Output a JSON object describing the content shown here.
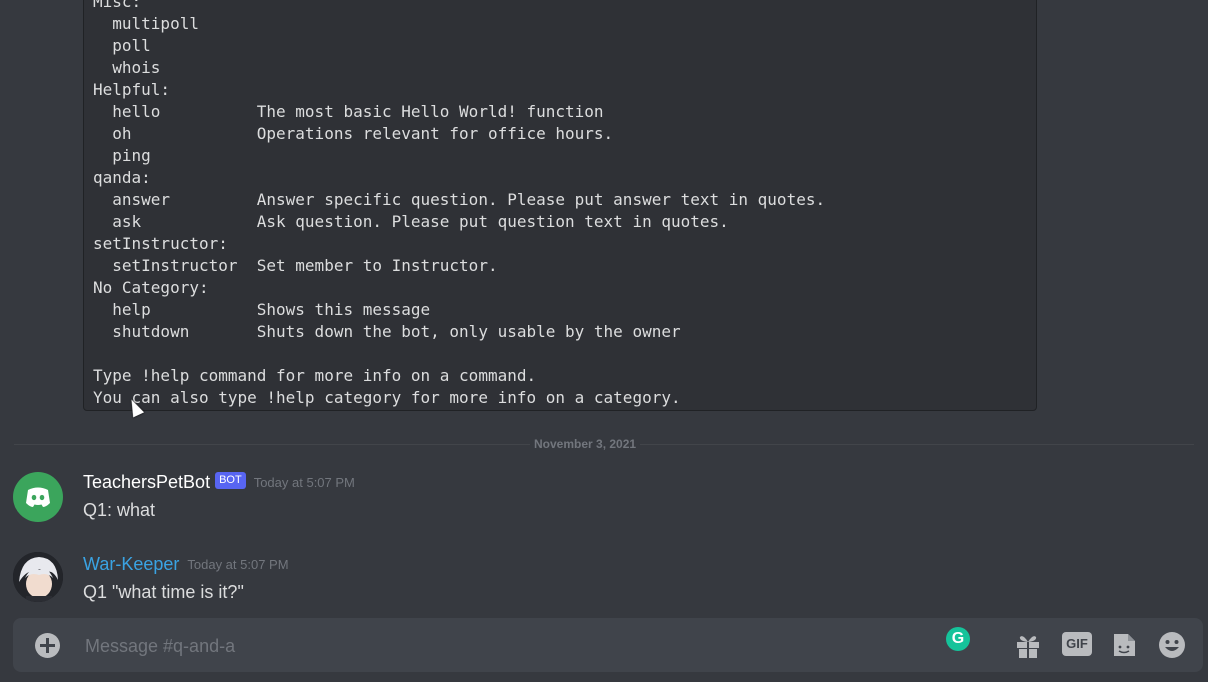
{
  "code_block": {
    "lines": [
      "Misc:",
      "  multipoll",
      "  poll",
      "  whois",
      "Helpful:",
      "  hello          The most basic Hello World! function",
      "  oh             Operations relevant for office hours.",
      "  ping",
      "qanda:",
      "  answer         Answer specific question. Please put answer text in quotes.",
      "  ask            Ask question. Please put question text in quotes.",
      "setInstructor:",
      "  setInstructor  Set member to Instructor.",
      "No Category:",
      "  help           Shows this message",
      "  shutdown       Shuts down the bot, only usable by the owner",
      "",
      "Type !help command for more info on a command.",
      "You can also type !help category for more info on a category."
    ]
  },
  "date_divider": "November 3, 2021",
  "messages": [
    {
      "author": "TeachersPetBot",
      "tag": "BOT",
      "timestamp": "Today at 5:07 PM",
      "content": "Q1: what"
    },
    {
      "author": "War-Keeper",
      "timestamp": "Today at 5:07 PM",
      "content": "Q1 \"what time is it?\""
    }
  ],
  "composer": {
    "placeholder": "Message #q-and-a",
    "gif_label": "GIF",
    "grammarly_label": "G"
  },
  "colors": {
    "background": "#36393f",
    "code_background": "#2f3136",
    "bot_avatar": "#3ba55c",
    "bot_tag": "#5865f2",
    "user_name": "#3aa3e3",
    "grammarly": "#15c39a"
  },
  "icons": [
    "add-attachment-icon",
    "grammarly-icon",
    "gift-icon",
    "gif-icon",
    "sticker-icon",
    "emoji-icon",
    "discord-logo-icon",
    "mouse-cursor-icon"
  ]
}
